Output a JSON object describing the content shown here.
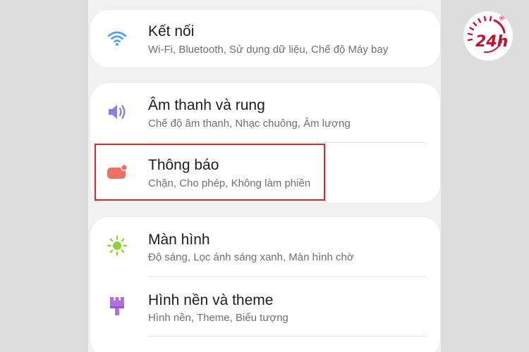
{
  "settings": {
    "connections": {
      "title": "Kết nối",
      "subtitle": "Wi-Fi, Bluetooth, Sử dụng dữ liệu, Chế độ Máy bay",
      "icon": "wifi-icon",
      "icon_color": "#4aa3f0"
    },
    "sound": {
      "title": "Âm thanh và rung",
      "subtitle": "Chế độ âm thanh, Nhạc chuông, Âm lượng",
      "icon": "speaker-icon",
      "icon_color": "#8a7de8"
    },
    "notifications": {
      "title": "Thông báo",
      "subtitle": "Chặn, Cho phép, Không làm phiền",
      "icon": "notification-badge-icon",
      "icon_color": "#ef6f64"
    },
    "display": {
      "title": "Màn hình",
      "subtitle": "Độ sáng, Lọc ánh sáng xanh, Màn hình chờ",
      "icon": "sun-icon",
      "icon_color": "#8ed13a"
    },
    "wallpaper": {
      "title": "Hình nền và theme",
      "subtitle": "Hình nền, Theme, Biểu tượng",
      "icon": "paintbrush-icon",
      "icon_color": "#b16ee0"
    }
  },
  "highlight_color": "#d42a2a",
  "logo": {
    "name": "24h-logo",
    "text": "24h",
    "registered_mark": "®",
    "color": "#c8102e"
  }
}
